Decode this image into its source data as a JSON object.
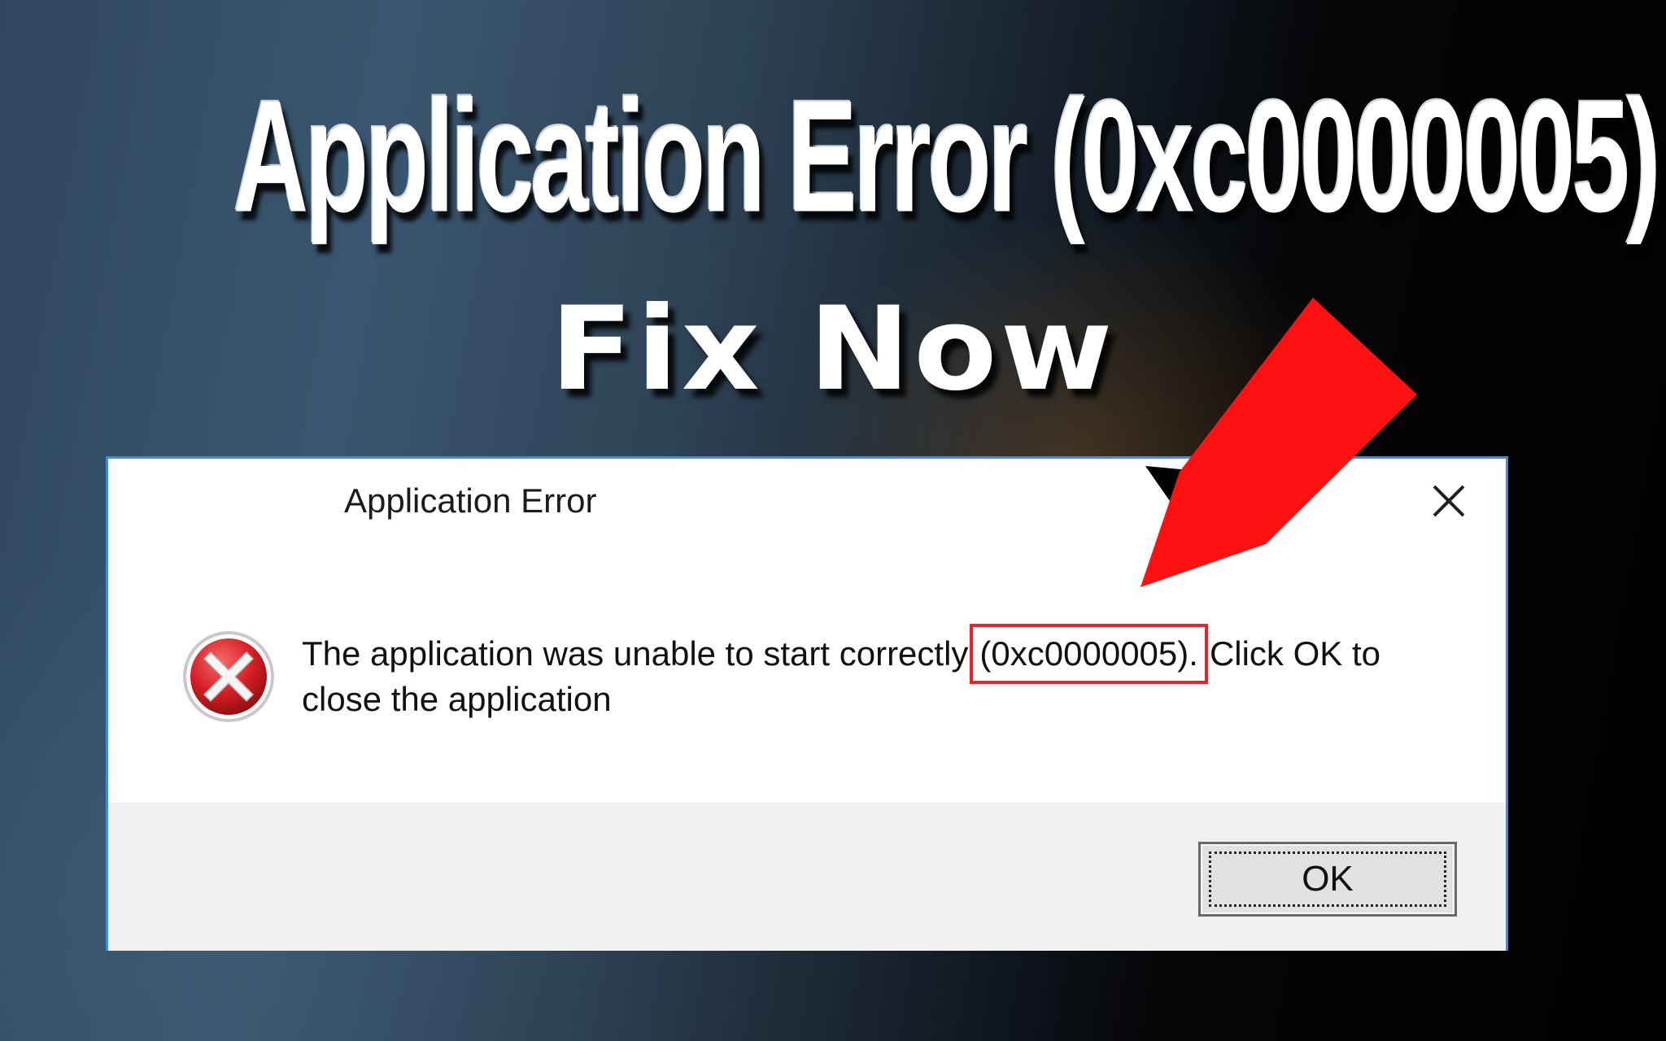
{
  "headline": {
    "line1": "Application Error (0xc0000005)",
    "line2": "Fix Now"
  },
  "dialog": {
    "title": "Application Error",
    "close_icon": "close-icon",
    "error_icon": "error-x-icon",
    "message": {
      "before_code": "The application was unable to start correctly",
      "code": "(0xc0000005).",
      "after_code": "Click OK to",
      "line2": "close the application"
    },
    "ok_label": "OK"
  },
  "colors": {
    "highlight_box": "#e8242a",
    "arrow": "#ff1111",
    "dialog_border": "#3c8ee0"
  }
}
